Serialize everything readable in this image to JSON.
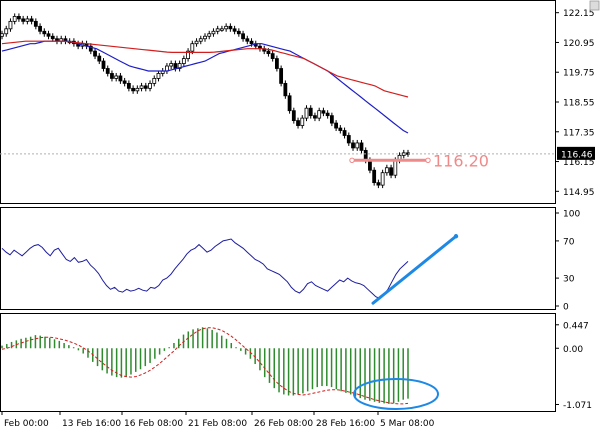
{
  "chart_data": [
    {
      "type": "candlestick",
      "panel": "price",
      "ylim": [
        114.6,
        122.5
      ],
      "yticks": [
        {
          "label": "122.15",
          "value": 122.15
        },
        {
          "label": "120.95",
          "value": 120.95
        },
        {
          "label": "119.75",
          "value": 119.75
        },
        {
          "label": "118.55",
          "value": 118.55
        },
        {
          "label": "117.35",
          "value": 117.35
        },
        {
          "label": "116.15",
          "value": 116.15
        },
        {
          "label": "114.95",
          "value": 114.95
        }
      ],
      "current_price_label": "116.46",
      "current_price": 116.46,
      "annotation": {
        "text": "116.20",
        "value": 116.2,
        "color": "#ef8a8a"
      },
      "closes": [
        121.3,
        121.5,
        121.8,
        122.0,
        121.9,
        121.8,
        121.9,
        121.8,
        121.6,
        121.4,
        121.3,
        121.2,
        121.1,
        121.0,
        121.1,
        121.0,
        121.0,
        120.9,
        120.8,
        120.9,
        120.8,
        120.6,
        120.4,
        120.2,
        119.9,
        119.7,
        119.5,
        119.6,
        119.4,
        119.3,
        119.1,
        119.0,
        119.1,
        119.2,
        119.1,
        119.3,
        119.5,
        119.7,
        119.8,
        120.0,
        120.1,
        119.9,
        120.1,
        120.3,
        120.6,
        120.9,
        121.0,
        121.1,
        121.2,
        121.3,
        121.4,
        121.5,
        121.5,
        121.6,
        121.5,
        121.4,
        121.3,
        121.1,
        121.0,
        120.9,
        120.8,
        120.7,
        120.6,
        120.5,
        120.3,
        119.9,
        119.3,
        118.8,
        118.2,
        117.8,
        117.6,
        117.9,
        118.3,
        118.0,
        117.9,
        118.2,
        118.1,
        118.0,
        117.7,
        117.5,
        117.4,
        117.2,
        116.9,
        116.7,
        116.9,
        116.6,
        116.2,
        115.8,
        115.3,
        115.2,
        115.7,
        115.9,
        115.6,
        116.2,
        116.4,
        116.5,
        116.46
      ],
      "series": [
        {
          "name": "",
          "color": "#1e1ec8",
          "values": [
            120.6,
            120.65,
            120.7,
            120.75,
            120.8,
            120.85,
            120.9,
            120.9,
            120.95,
            121.0,
            121.0,
            121.0,
            121.0,
            121.0,
            121.0,
            120.95,
            120.9,
            120.85,
            120.8,
            120.75,
            120.7,
            120.6,
            120.5,
            120.4,
            120.3,
            120.2,
            120.1,
            120.0,
            119.95,
            119.9,
            119.85,
            119.8,
            119.8,
            119.8,
            119.8,
            119.8,
            119.85,
            119.9,
            119.95,
            120.0,
            120.05,
            120.1,
            120.15,
            120.2,
            120.3,
            120.4,
            120.5,
            120.55,
            120.6,
            120.65,
            120.7,
            120.75,
            120.8,
            120.85,
            120.9,
            120.9,
            120.85,
            120.8,
            120.75,
            120.7,
            120.65,
            120.6,
            120.5,
            120.4,
            120.3,
            120.2,
            120.1,
            120.0,
            119.9,
            119.8,
            119.65,
            119.5,
            119.35,
            119.2,
            119.05,
            118.9,
            118.75,
            118.6,
            118.45,
            118.3,
            118.15,
            118.0,
            117.85,
            117.7,
            117.55,
            117.4,
            117.3
          ]
        },
        {
          "name": "",
          "color": "#d21e1e",
          "values": [
            120.9,
            120.92,
            120.94,
            120.96,
            120.98,
            121.0,
            121.0,
            121.0,
            121.0,
            121.0,
            121.0,
            121.0,
            121.0,
            121.0,
            120.98,
            120.96,
            120.94,
            120.92,
            120.9,
            120.88,
            120.86,
            120.84,
            120.82,
            120.8,
            120.78,
            120.76,
            120.74,
            120.72,
            120.7,
            120.68,
            120.66,
            120.64,
            120.62,
            120.6,
            120.58,
            120.56,
            120.55,
            120.55,
            120.55,
            120.55,
            120.55,
            120.55,
            120.55,
            120.55,
            120.55,
            120.56,
            120.58,
            120.6,
            120.62,
            120.64,
            120.66,
            120.68,
            120.7,
            120.7,
            120.7,
            120.7,
            120.68,
            120.65,
            120.6,
            120.55,
            120.5,
            120.45,
            120.4,
            120.35,
            120.3,
            120.2,
            120.1,
            120.0,
            119.9,
            119.8,
            119.7,
            119.6,
            119.55,
            119.5,
            119.45,
            119.4,
            119.35,
            119.3,
            119.25,
            119.2,
            119.1,
            119.0,
            118.95,
            118.9,
            118.85,
            118.8,
            118.75
          ]
        }
      ]
    },
    {
      "type": "line",
      "panel": "oscillator",
      "ylim": [
        0,
        100
      ],
      "yticks": [
        {
          "label": "100",
          "value": 100
        },
        {
          "label": "70",
          "value": 70
        },
        {
          "label": "30",
          "value": 30
        },
        {
          "label": "0",
          "value": 0
        }
      ],
      "series": [
        {
          "name": "",
          "color": "#1e1ea0",
          "values": [
            62,
            58,
            55,
            60,
            57,
            54,
            58,
            62,
            65,
            66,
            63,
            58,
            54,
            60,
            62,
            56,
            50,
            48,
            52,
            47,
            48,
            50,
            44,
            40,
            35,
            28,
            22,
            18,
            20,
            16,
            15,
            18,
            16,
            17,
            19,
            17,
            16,
            20,
            19,
            22,
            28,
            30,
            34,
            40,
            45,
            50,
            56,
            60,
            62,
            66,
            62,
            58,
            60,
            64,
            67,
            70,
            71,
            72,
            68,
            65,
            62,
            58,
            54,
            50,
            48,
            45,
            40,
            38,
            36,
            34,
            30,
            26,
            20,
            16,
            14,
            18,
            24,
            26,
            22,
            20,
            18,
            16,
            20,
            24,
            28,
            26,
            30,
            27,
            25,
            24,
            22,
            18,
            14,
            10,
            8,
            12,
            18,
            26,
            34,
            40,
            44,
            48
          ]
        }
      ],
      "trendline": {
        "color": "#1e88e5",
        "start_value": 3,
        "end_value": 75
      }
    },
    {
      "type": "bar",
      "panel": "macd",
      "ylim": [
        -1.1,
        0.5
      ],
      "yticks": [
        {
          "label": "0.447",
          "value": 0.447
        },
        {
          "label": "0.00",
          "value": 0.0
        },
        {
          "label": "-1.071",
          "value": -1.071
        }
      ],
      "bars": [
        0.05,
        0.08,
        0.12,
        0.15,
        0.18,
        0.2,
        0.22,
        0.25,
        0.24,
        0.22,
        0.2,
        0.17,
        0.14,
        0.1,
        0.06,
        0.02,
        -0.04,
        -0.1,
        -0.18,
        -0.26,
        -0.34,
        -0.42,
        -0.48,
        -0.52,
        -0.55,
        -0.56,
        -0.54,
        -0.5,
        -0.45,
        -0.4,
        -0.34,
        -0.28,
        -0.2,
        -0.12,
        -0.05,
        0.02,
        0.1,
        0.18,
        0.26,
        0.32,
        0.36,
        0.38,
        0.4,
        0.38,
        0.35,
        0.3,
        0.24,
        0.18,
        0.1,
        0.02,
        -0.05,
        -0.12,
        -0.2,
        -0.3,
        -0.42,
        -0.55,
        -0.66,
        -0.76,
        -0.84,
        -0.88,
        -0.9,
        -0.9,
        -0.88,
        -0.86,
        -0.82,
        -0.78,
        -0.74,
        -0.72,
        -0.72,
        -0.74,
        -0.78,
        -0.82,
        -0.85,
        -0.88,
        -0.92,
        -0.95,
        -0.98,
        -1.0,
        -1.02,
        -1.04,
        -1.05,
        -1.06,
        -1.05,
        -1.02,
        -0.98,
        -0.96
      ],
      "bar_color": "#2e8b2e",
      "signal": {
        "name": "",
        "color": "#d21e1e",
        "values": [
          -0.02,
          0.0,
          0.03,
          0.07,
          0.1,
          0.13,
          0.16,
          0.18,
          0.2,
          0.21,
          0.21,
          0.2,
          0.18,
          0.16,
          0.13,
          0.1,
          0.06,
          0.01,
          -0.05,
          -0.12,
          -0.2,
          -0.28,
          -0.35,
          -0.42,
          -0.47,
          -0.52,
          -0.54,
          -0.55,
          -0.54,
          -0.51,
          -0.47,
          -0.42,
          -0.36,
          -0.29,
          -0.21,
          -0.13,
          -0.05,
          0.04,
          0.12,
          0.2,
          0.27,
          0.33,
          0.37,
          0.39,
          0.39,
          0.37,
          0.34,
          0.29,
          0.23,
          0.16,
          0.08,
          0.0,
          -0.08,
          -0.17,
          -0.27,
          -0.38,
          -0.49,
          -0.6,
          -0.69,
          -0.76,
          -0.82,
          -0.86,
          -0.88,
          -0.89,
          -0.88,
          -0.86,
          -0.84,
          -0.82,
          -0.8,
          -0.79,
          -0.79,
          -0.8,
          -0.82,
          -0.84,
          -0.86,
          -0.89,
          -0.92,
          -0.95,
          -0.98,
          -1.0,
          -1.02,
          -1.04,
          -1.05,
          -1.06,
          -1.06,
          -1.05
        ]
      },
      "ellipse": {
        "color": "#1e88e5"
      }
    }
  ],
  "xaxis": {
    "labels": [
      "Feb 00:00",
      "13 Feb 16:00",
      "16 Feb 08:00",
      "21 Feb 08:00",
      "26 Feb 08:00",
      "28 Feb 16:00",
      "5 Mar 08:00"
    ]
  },
  "colors": {
    "bull_candle": "#ffffff",
    "bear_candle": "#000000",
    "grid": "none",
    "panel_border": "#000000",
    "price_label_bg": "#000000"
  }
}
